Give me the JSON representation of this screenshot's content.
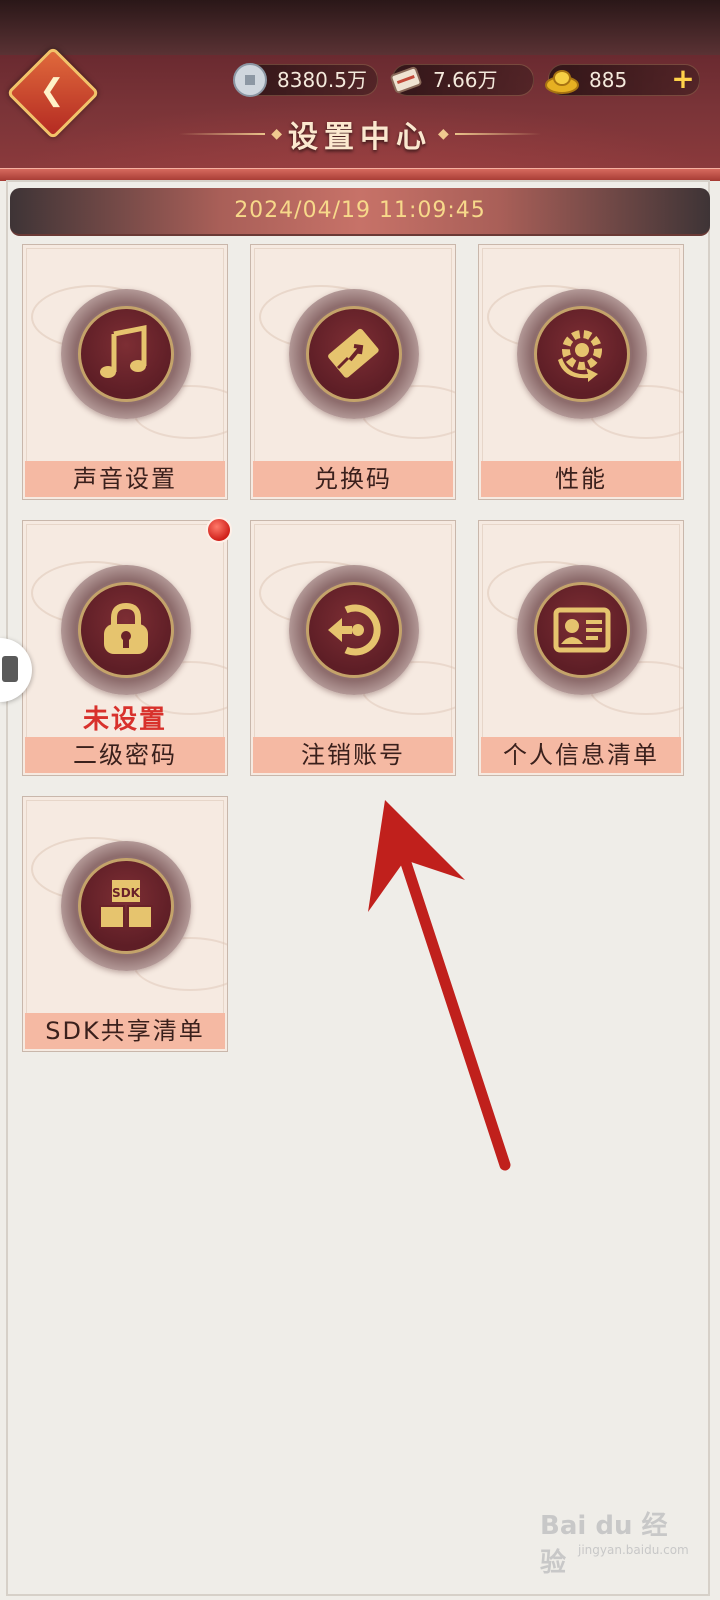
{
  "header": {
    "title": "设置中心",
    "resources": [
      {
        "name": "silver-coin",
        "value": "8380.5万"
      },
      {
        "name": "scroll",
        "value": "7.66万"
      },
      {
        "name": "gold-ingot",
        "value": "885"
      }
    ],
    "plus_label": "+"
  },
  "datetime": "2024/04/19 11:09:45",
  "tiles": [
    {
      "label": "声音设置",
      "icon": "music-note-icon"
    },
    {
      "label": "兑换码",
      "icon": "ticket-icon"
    },
    {
      "label": "性能",
      "icon": "gear-refresh-icon"
    },
    {
      "label": "二级密码",
      "icon": "lock-icon",
      "status": "未设置",
      "badge": true
    },
    {
      "label": "注销账号",
      "icon": "logout-icon"
    },
    {
      "label": "个人信息清单",
      "icon": "id-card-icon"
    },
    {
      "label": "SDK共享清单",
      "icon": "sdk-cubes-icon",
      "icon_text": "SDK"
    }
  ],
  "watermark": {
    "main": "Bai du 经验",
    "sub": "jingyan.baidu.com"
  },
  "colors": {
    "accent": "#8c3a3c",
    "gold": "#d9b866",
    "alert": "#d8312c",
    "arrow": "#c0201c"
  }
}
